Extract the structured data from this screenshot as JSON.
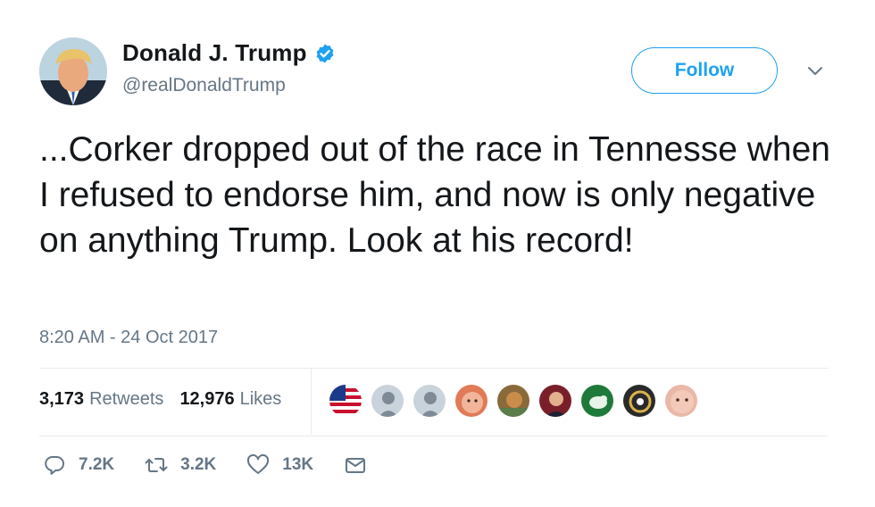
{
  "user": {
    "display_name": "Donald J. Trump",
    "handle": "@realDonaldTrump",
    "verified": true
  },
  "follow_label": "Follow",
  "tweet_text": "...Corker dropped out of the race in Tennesse when I refused to endorse him, and now is only negative on anything Trump. Look at his record!",
  "timestamp": "8:20 AM - 24 Oct 2017",
  "stats": {
    "retweets_count": "3,173",
    "retweets_label": "Retweets",
    "likes_count": "12,976",
    "likes_label": "Likes"
  },
  "likers": [
    {
      "icon": "us-flag-avatar"
    },
    {
      "icon": "default-avatar"
    },
    {
      "icon": "default-avatar"
    },
    {
      "icon": "face-avatar"
    },
    {
      "icon": "painting-avatar"
    },
    {
      "icon": "portrait-avatar"
    },
    {
      "icon": "green-bird-avatar"
    },
    {
      "icon": "circle-logo-avatar"
    },
    {
      "icon": "face-avatar"
    }
  ],
  "actions": {
    "reply_count": "7.2K",
    "retweet_count": "3.2K",
    "like_count": "13K"
  },
  "colors": {
    "accent": "#1da1f2",
    "text": "#14171a",
    "muted": "#657786",
    "divider": "#e6ecf0"
  }
}
